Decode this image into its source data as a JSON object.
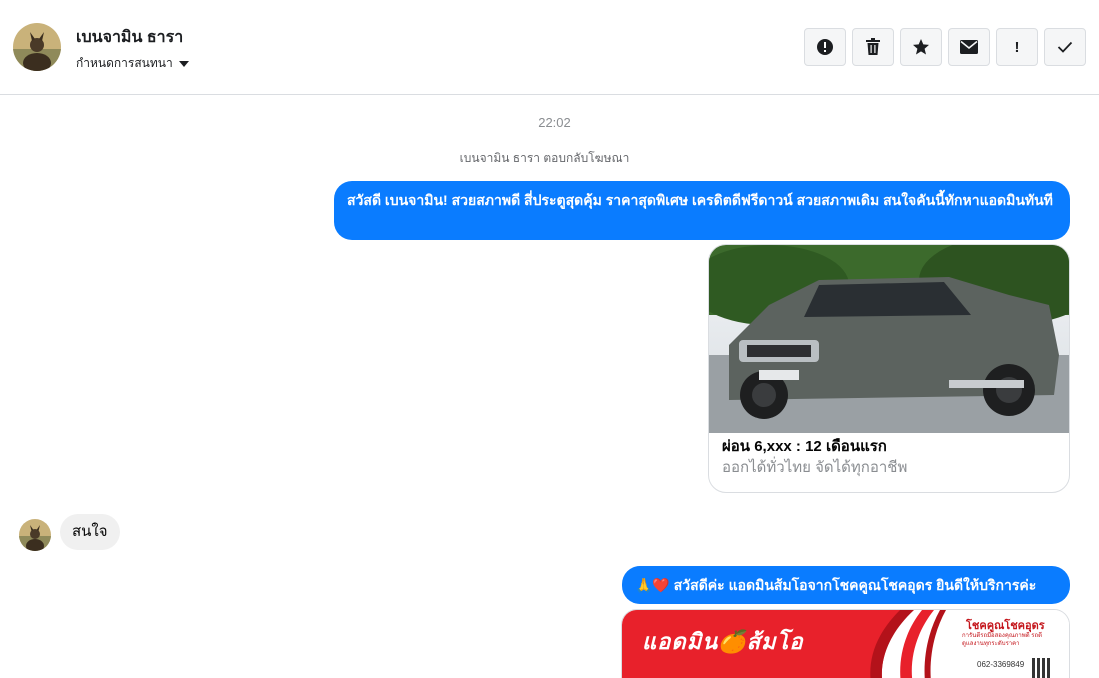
{
  "header": {
    "name": "เบนจามิน ธารา",
    "subtitle": "กำหนดการสนทนา"
  },
  "actions": [
    {
      "icon": "alert-circle-icon",
      "glyph": ""
    },
    {
      "icon": "trash-icon",
      "glyph": ""
    },
    {
      "icon": "star-icon",
      "glyph": ""
    },
    {
      "icon": "envelope-icon",
      "glyph": ""
    },
    {
      "icon": "exclamation-icon",
      "glyph": "!"
    },
    {
      "icon": "check-icon",
      "glyph": ""
    }
  ],
  "conversation": {
    "time": "22:02",
    "reply_note": "เบนจามิน ธารา ตอบกลับโฆษณา",
    "message_1": "สวัสดี เบนจามิน! สวยสภาพดี สี่ประตูสุดคุ้ม ราคาสุดพิเศษ เครดิตดีฟรีดาวน์ สวยสภาพเดิม สนใจคันนี้ทักหาแอดมินทันที",
    "card": {
      "title": "ผ่อน 6,xxx : 12 เดือนแรก",
      "subtitle": "ออกได้ทั่วไทย จัดได้ทุกอาชีพ"
    },
    "incoming": "สนใจ",
    "message_2": "🙏❤️ สวัสดีค่ะ แอดมินส้มโอจากโชคคูณโชคอุดร ยินดีให้บริการค่ะ",
    "banner": {
      "headline": "แอดมิน🍊ส้มโอ",
      "brand": "โชคคูณโชคอุดร",
      "tagline": "การันตีรถมือสองคุณภาพดี รถดี ดูแลงานทุกระดับราคา",
      "phone": "062-3369849"
    }
  },
  "colors": {
    "outgoing_bubble": "#0a7cff",
    "incoming_bubble": "#f0f0f0",
    "banner_red": "#e8212b"
  }
}
